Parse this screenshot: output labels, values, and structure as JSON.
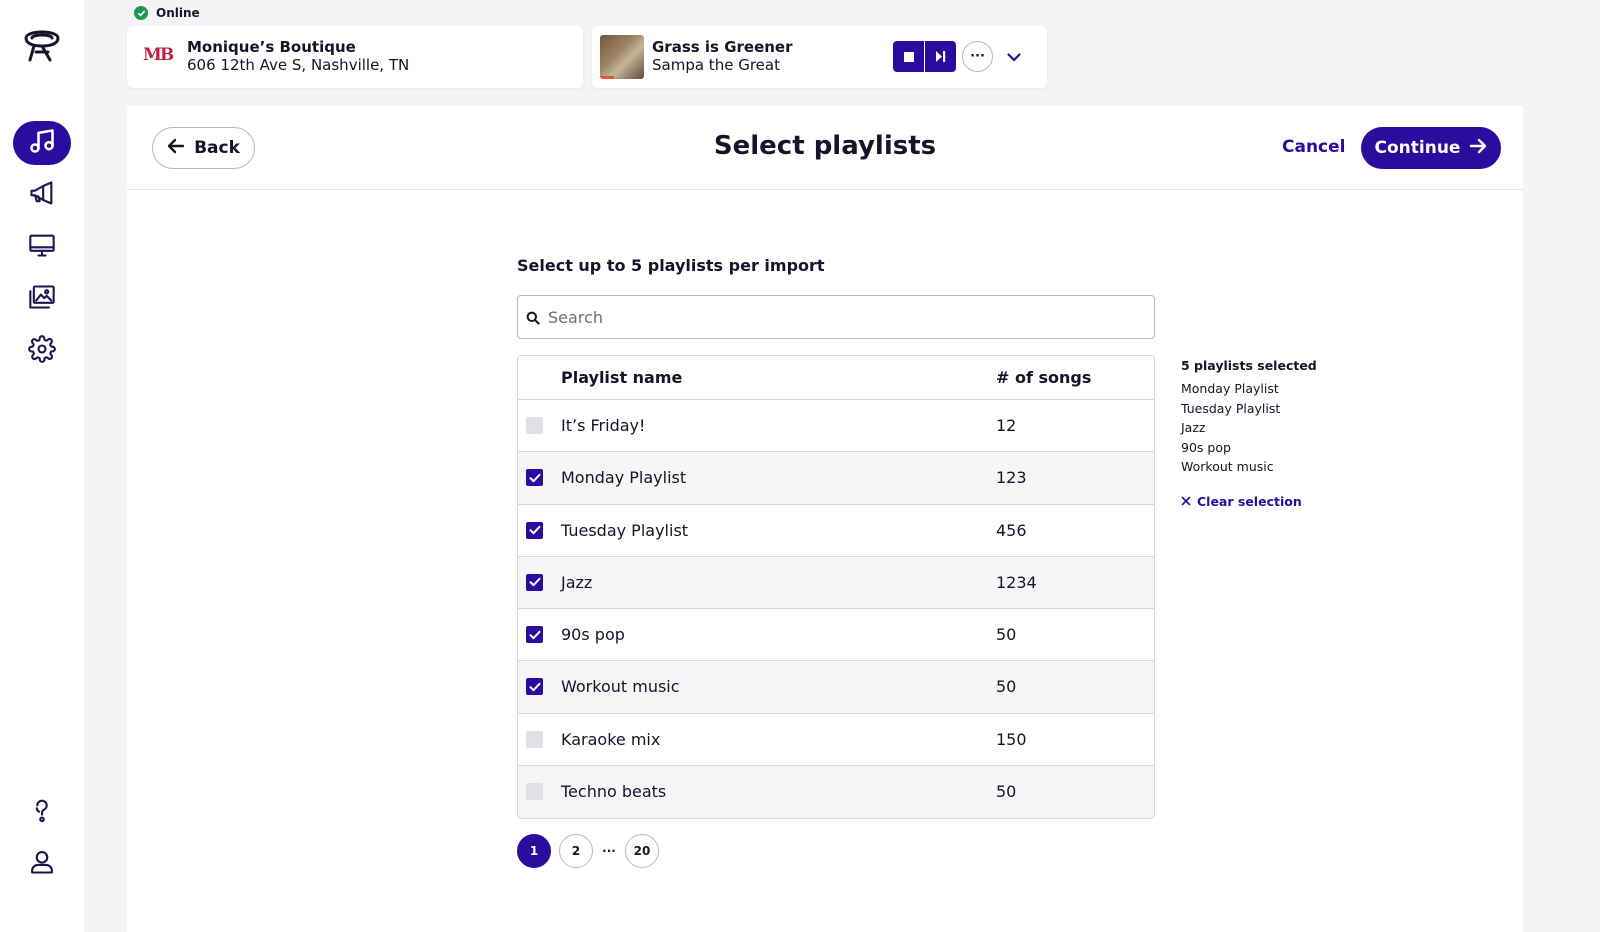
{
  "status": {
    "label": "Online",
    "color": "#1a9a4a"
  },
  "location": {
    "logo": "MB",
    "name": "Monique’s Boutique",
    "address": "606 12th Ave S, Nashville, TN"
  },
  "player": {
    "track": "Grass is Greener",
    "artist": "Sampa the Great",
    "more_label": "···"
  },
  "sidebar": {
    "items": [
      {
        "name": "music",
        "icon": "music-note-icon",
        "active": true
      },
      {
        "name": "announcements",
        "icon": "megaphone-icon",
        "active": false
      },
      {
        "name": "display",
        "icon": "monitor-icon",
        "active": false
      },
      {
        "name": "media",
        "icon": "images-icon",
        "active": false
      },
      {
        "name": "settings",
        "icon": "gear-icon",
        "active": false
      }
    ],
    "bottom": [
      {
        "name": "help",
        "icon": "help-icon"
      },
      {
        "name": "account",
        "icon": "user-icon"
      }
    ]
  },
  "header": {
    "back_label": "Back",
    "title": "Select playlists",
    "cancel_label": "Cancel",
    "continue_label": "Continue"
  },
  "instruction": "Select up to 5 playlists per import",
  "search": {
    "placeholder": "Search",
    "value": ""
  },
  "table": {
    "columns": [
      "Playlist name",
      "# of songs"
    ],
    "rows": [
      {
        "name": "It’s Friday!",
        "count": "12",
        "checked": false
      },
      {
        "name": "Monday Playlist",
        "count": "123",
        "checked": true
      },
      {
        "name": "Tuesday Playlist",
        "count": "456",
        "checked": true
      },
      {
        "name": "Jazz",
        "count": "1234",
        "checked": true
      },
      {
        "name": "90s pop",
        "count": "50",
        "checked": true
      },
      {
        "name": "Workout music",
        "count": "50",
        "checked": true
      },
      {
        "name": "Karaoke mix",
        "count": "150",
        "checked": false
      },
      {
        "name": "Techno beats",
        "count": "50",
        "checked": false
      }
    ]
  },
  "pagination": {
    "pages": [
      "1",
      "2",
      "20"
    ],
    "ellipsis": "···",
    "current": "1"
  },
  "selection": {
    "title": "5 playlists selected",
    "items": [
      "Monday Playlist",
      "Tuesday Playlist",
      "Jazz",
      "90s pop",
      "Workout music"
    ],
    "clear_label": "Clear selection"
  },
  "colors": {
    "accent": "#2a0c9e",
    "online": "#1a9a4a",
    "brand_logo": "#c41f4a"
  }
}
